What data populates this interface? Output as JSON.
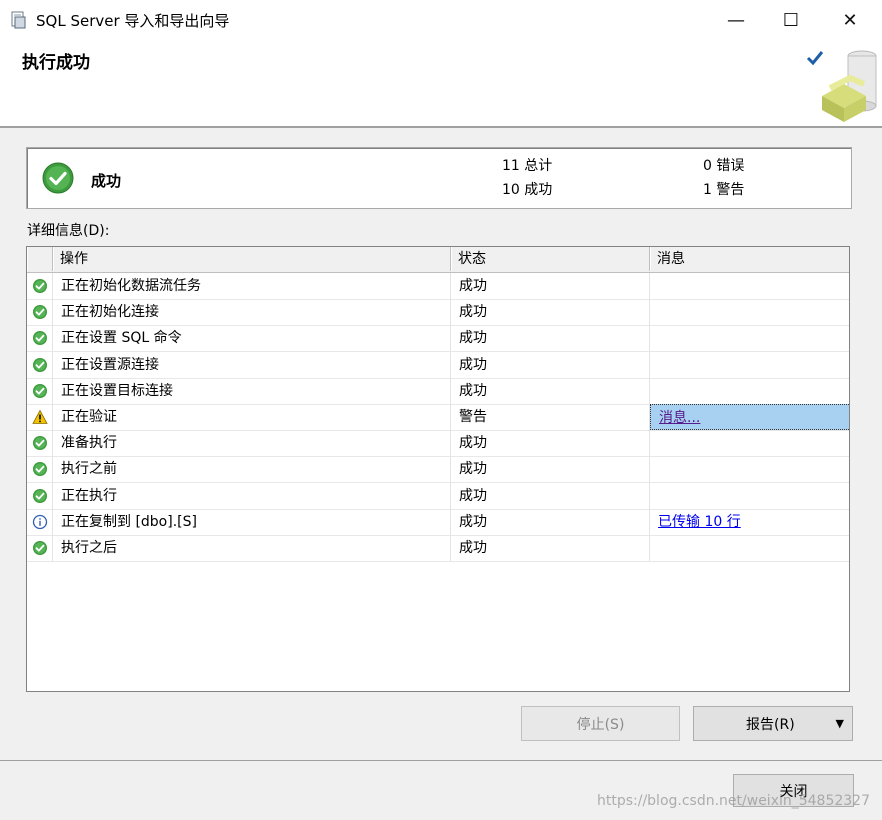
{
  "window": {
    "title": "SQL Server 导入和导出向导",
    "controls": {
      "minimize": "—",
      "maximize": "☐",
      "close": "✕"
    }
  },
  "header": {
    "title": "执行成功"
  },
  "summary": {
    "result": "成功",
    "total": "11 总计",
    "success": "10 成功",
    "errors": "0 错误",
    "warnings": "1 警告"
  },
  "details": {
    "label": "详细信息(D):",
    "columns": [
      "操作",
      "状态",
      "消息"
    ],
    "rows": [
      {
        "icon": "success",
        "action": "正在初始化数据流任务",
        "status": "成功",
        "message": ""
      },
      {
        "icon": "success",
        "action": "正在初始化连接",
        "status": "成功",
        "message": ""
      },
      {
        "icon": "success",
        "action": "正在设置 SQL 命令",
        "status": "成功",
        "message": ""
      },
      {
        "icon": "success",
        "action": "正在设置源连接",
        "status": "成功",
        "message": ""
      },
      {
        "icon": "success",
        "action": "正在设置目标连接",
        "status": "成功",
        "message": ""
      },
      {
        "icon": "warning",
        "action": "正在验证",
        "status": "警告",
        "message": "消息..."
      },
      {
        "icon": "success",
        "action": "准备执行",
        "status": "成功",
        "message": ""
      },
      {
        "icon": "success",
        "action": "执行之前",
        "status": "成功",
        "message": ""
      },
      {
        "icon": "success",
        "action": "正在执行",
        "status": "成功",
        "message": ""
      },
      {
        "icon": "info",
        "action": "正在复制到 [dbo].[S]",
        "status": "成功",
        "message": "已传输 10 行"
      },
      {
        "icon": "success",
        "action": "执行之后",
        "status": "成功",
        "message": ""
      }
    ]
  },
  "buttons": {
    "stop": "停止(S)",
    "report": "报告(R)",
    "report_arrow": "▼",
    "close": "关闭"
  },
  "watermark": "https://blog.csdn.net/weixin_54852327",
  "colors": {
    "success": "#3d9a3d",
    "warning": "#f2c200",
    "info": "#3060b0",
    "selection": "#a8d0f0",
    "link": "#0000ee"
  }
}
